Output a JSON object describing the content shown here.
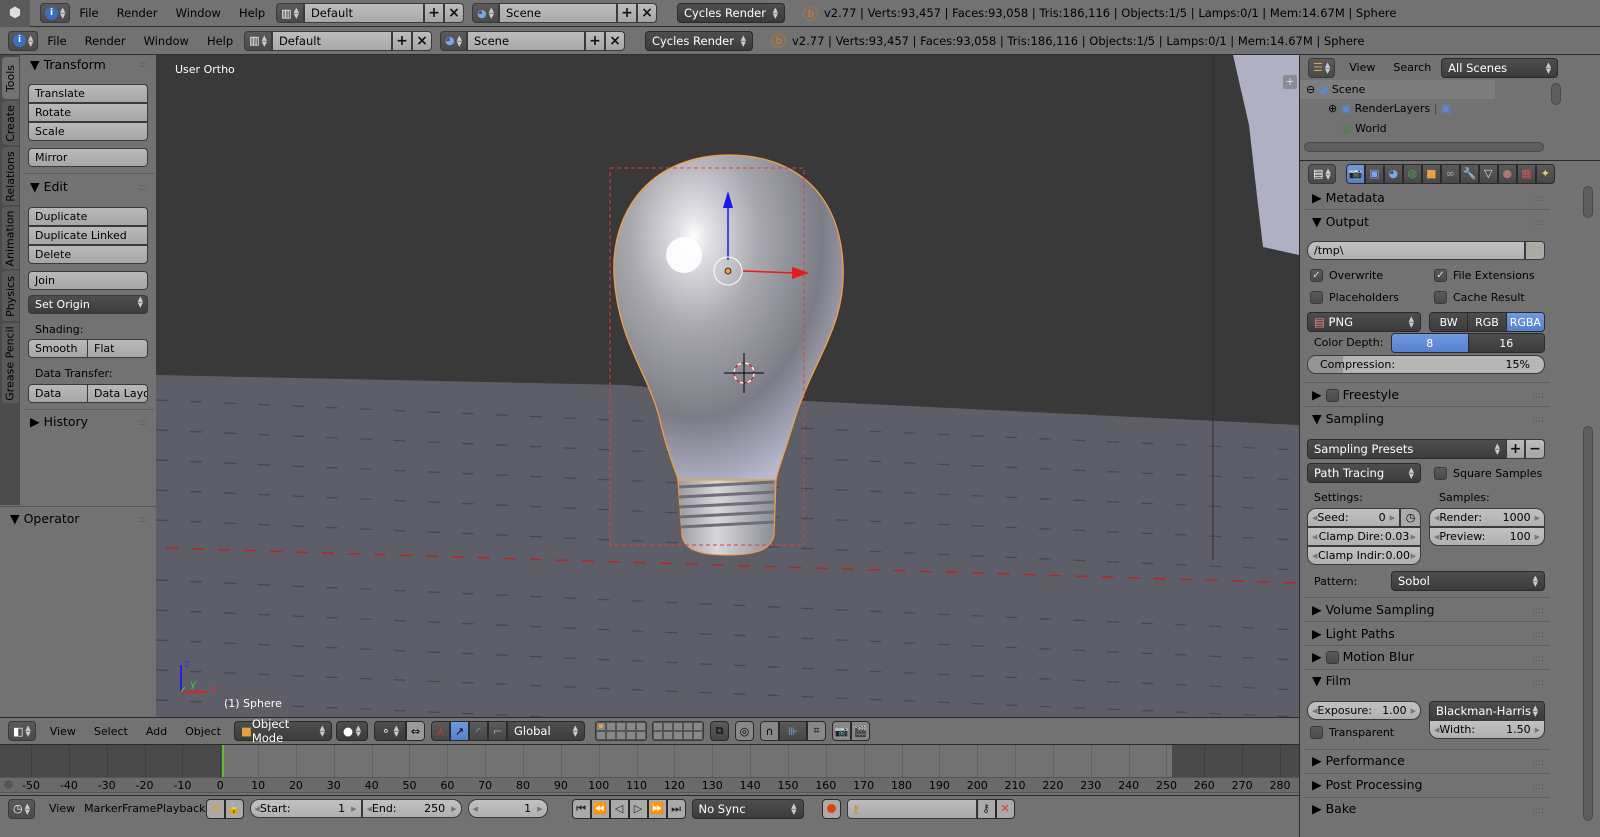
{
  "top_header": {
    "menus": [
      "File",
      "Render",
      "Window",
      "Help"
    ],
    "layout": "Default",
    "scene": "Scene",
    "engine": "Cycles Render",
    "stats": "v2.77 | Verts:93,457 | Faces:93,058 | Tris:186,116 | Objects:1/5 | Lamps:0/1 | Mem:14.67M | Sphere"
  },
  "info_header": {
    "menus": [
      "File",
      "Render",
      "Window",
      "Help"
    ],
    "layout": "Default",
    "scene": "Scene",
    "engine": "Cycles Render",
    "stats": "v2.77 | Verts:93,457 | Faces:93,058 | Tris:186,116 | Objects:1/5 | Lamps:0/1 | Mem:14.67M | Sphere"
  },
  "tool_tabs": [
    "Tools",
    "Create",
    "Relations",
    "Animation",
    "Physics",
    "Grease Pencil"
  ],
  "toolshelf": {
    "transform_title": "Transform",
    "transform_buttons": [
      "Translate",
      "Rotate",
      "Scale"
    ],
    "mirror": "Mirror",
    "edit_title": "Edit",
    "edit_buttons": [
      "Duplicate",
      "Duplicate Linked",
      "Delete"
    ],
    "join": "Join",
    "set_origin": "Set Origin",
    "shading_label": "Shading:",
    "smooth": "Smooth",
    "flat": "Flat",
    "data_transfer_label": "Data Transfer:",
    "data": "Data",
    "data_layout": "Data Layo",
    "history_title": "History",
    "operator_title": "Operator"
  },
  "viewport": {
    "view_label": "User Ortho",
    "object_label": "(1) Sphere",
    "axis_labels": {
      "x": "x",
      "y": "y",
      "z": "z"
    },
    "colors": {
      "selection": "#f0a040",
      "x_axis": "#e02020",
      "y_axis": "#30c030",
      "z_axis": "#2020e0"
    }
  },
  "view3d_header": {
    "menus": [
      "View",
      "Select",
      "Add",
      "Object"
    ],
    "mode": "Object Mode",
    "orientation": "Global"
  },
  "timeline": {
    "ticks": [
      "-50",
      "-40",
      "-30",
      "-20",
      "-10",
      "0",
      "10",
      "20",
      "30",
      "40",
      "50",
      "60",
      "70",
      "80",
      "90",
      "100",
      "110",
      "120",
      "130",
      "140",
      "150",
      "160",
      "170",
      "180",
      "190",
      "200",
      "210",
      "220",
      "230",
      "240",
      "250",
      "260",
      "270",
      "280"
    ],
    "current_frame_marker": "0"
  },
  "timeline_header": {
    "menus": [
      "View",
      "Marker",
      "Frame",
      "Playback"
    ],
    "start_label": "Start:",
    "start_value": "1",
    "end_label": "End:",
    "end_value": "250",
    "current_frame": "1",
    "sync": "No Sync"
  },
  "outliner": {
    "menus": [
      "View",
      "Search"
    ],
    "filter": "All Scenes",
    "items": [
      "Scene",
      "RenderLayers",
      "World"
    ]
  },
  "properties": {
    "metadata": "Metadata",
    "output": {
      "title": "Output",
      "path": "/tmp\\",
      "overwrite": "Overwrite",
      "overwrite_checked": true,
      "file_extensions": "File Extensions",
      "file_extensions_checked": true,
      "placeholders": "Placeholders",
      "placeholders_checked": false,
      "cache_result": "Cache Result",
      "cache_result_checked": false,
      "format": "PNG",
      "color_modes": [
        "BW",
        "RGB",
        "RGBA"
      ],
      "color_mode_active": "RGBA",
      "color_depth_label": "Color Depth:",
      "color_depths": [
        "8",
        "16"
      ],
      "color_depth_active": "8",
      "compression_label": "Compression:",
      "compression_value": "15%",
      "compression_fraction": 0.15
    },
    "freestyle": "Freestyle",
    "sampling": {
      "title": "Sampling",
      "presets": "Sampling Presets",
      "integrator": "Path Tracing",
      "square_samples": "Square Samples",
      "settings_label": "Settings:",
      "samples_label": "Samples:",
      "seed_label": "Seed:",
      "seed_value": "0",
      "clamp_direct_label": "Clamp Dire:",
      "clamp_direct_value": "0.03",
      "clamp_indirect_label": "Clamp Indir:",
      "clamp_indirect_value": "0.00",
      "render_label": "Render:",
      "render_value": "1000",
      "preview_label": "Preview:",
      "preview_value": "100",
      "pattern_label": "Pattern:",
      "pattern_value": "Sobol"
    },
    "volume_sampling": "Volume Sampling",
    "light_paths": "Light Paths",
    "motion_blur": "Motion Blur",
    "film": {
      "title": "Film",
      "exposure_label": "Exposure:",
      "exposure_value": "1.00",
      "filter": "Blackman-Harris",
      "width_label": "Width:",
      "width_value": "1.50",
      "transparent": "Transparent"
    },
    "performance": "Performance",
    "post_processing": "Post Processing",
    "bake": "Bake",
    "accent": "#5680cc"
  }
}
